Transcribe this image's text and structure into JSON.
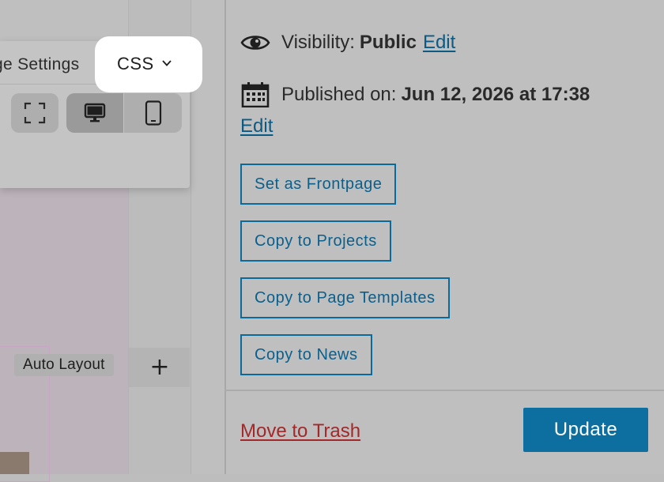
{
  "editor": {
    "auto_layout_label": "Auto Layout",
    "add_block_symbol": "+",
    "canvas_color": "#bcb4ba"
  },
  "popover": {
    "tab_page_settings": "ge Settings",
    "tab_css": "CSS",
    "toolbar": {
      "fullscreen_icon": "fullscreen-corners-icon",
      "desktop_icon": "desktop-monitor-icon",
      "mobile_icon": "mobile-phone-icon",
      "active_view": "desktop"
    }
  },
  "sidebar": {
    "visibility": {
      "icon": "eye-icon",
      "label": "Visibility:",
      "value": "Public",
      "edit_label": "Edit"
    },
    "published": {
      "icon": "calendar-icon",
      "label": "Published on:",
      "value": "Jun 12, 2026 at 17:38",
      "edit_label": "Edit"
    },
    "actions": [
      {
        "label": "Set as Frontpage"
      },
      {
        "label": "Copy to Projects"
      },
      {
        "label": "Copy to Page Templates"
      },
      {
        "label": "Copy to News"
      }
    ],
    "footer": {
      "trash_label": "Move to Trash",
      "update_label": "Update"
    }
  },
  "colors": {
    "link": "#0a5a84",
    "primary": "#0c6fa0",
    "danger": "#a3282a"
  }
}
